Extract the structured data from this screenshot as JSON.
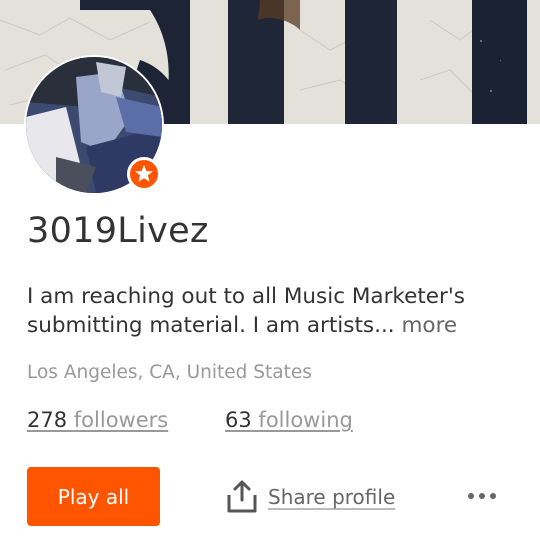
{
  "profile": {
    "username": "3019Livez",
    "bio_text": "I am reaching out to all Music Marketer's submitting material. I am artists...",
    "bio_more": "more",
    "location": "Los Angeles, CA, United States",
    "pro_badge_icon": "star-icon"
  },
  "stats": {
    "followers_count": "278",
    "followers_label": "followers",
    "following_count": "63",
    "following_label": "following"
  },
  "actions": {
    "play_all_label": "Play all",
    "share_label": "Share profile",
    "share_icon": "share-icon",
    "more_icon": "more-horizontal-icon"
  },
  "colors": {
    "accent": "#ff5500",
    "text_primary": "#333333",
    "text_secondary": "#999999"
  }
}
